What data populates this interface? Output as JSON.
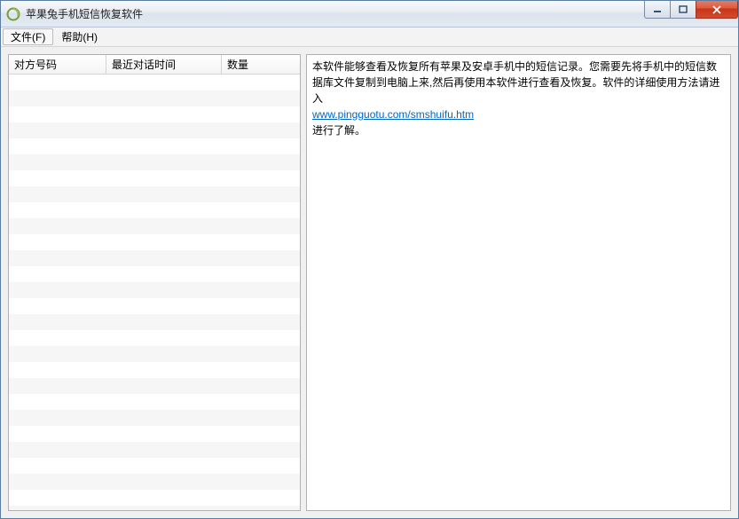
{
  "window": {
    "title": "苹果兔手机短信恢复软件"
  },
  "menubar": {
    "file": "文件(F)",
    "help": "帮助(H)"
  },
  "table": {
    "columns": {
      "c1": "对方号码",
      "c2": "最近对话时间",
      "c3": "数量"
    },
    "rows": []
  },
  "info": {
    "text1": "本软件能够查看及恢复所有苹果及安卓手机中的短信记录。您需要先将手机中的短信数据库文件复制到电脑上来,然后再使用本软件进行查看及恢复。软件的详细使用方法请进入",
    "link": "www.pingguotu.com/smshuifu.htm",
    "text2": "进行了解。"
  }
}
